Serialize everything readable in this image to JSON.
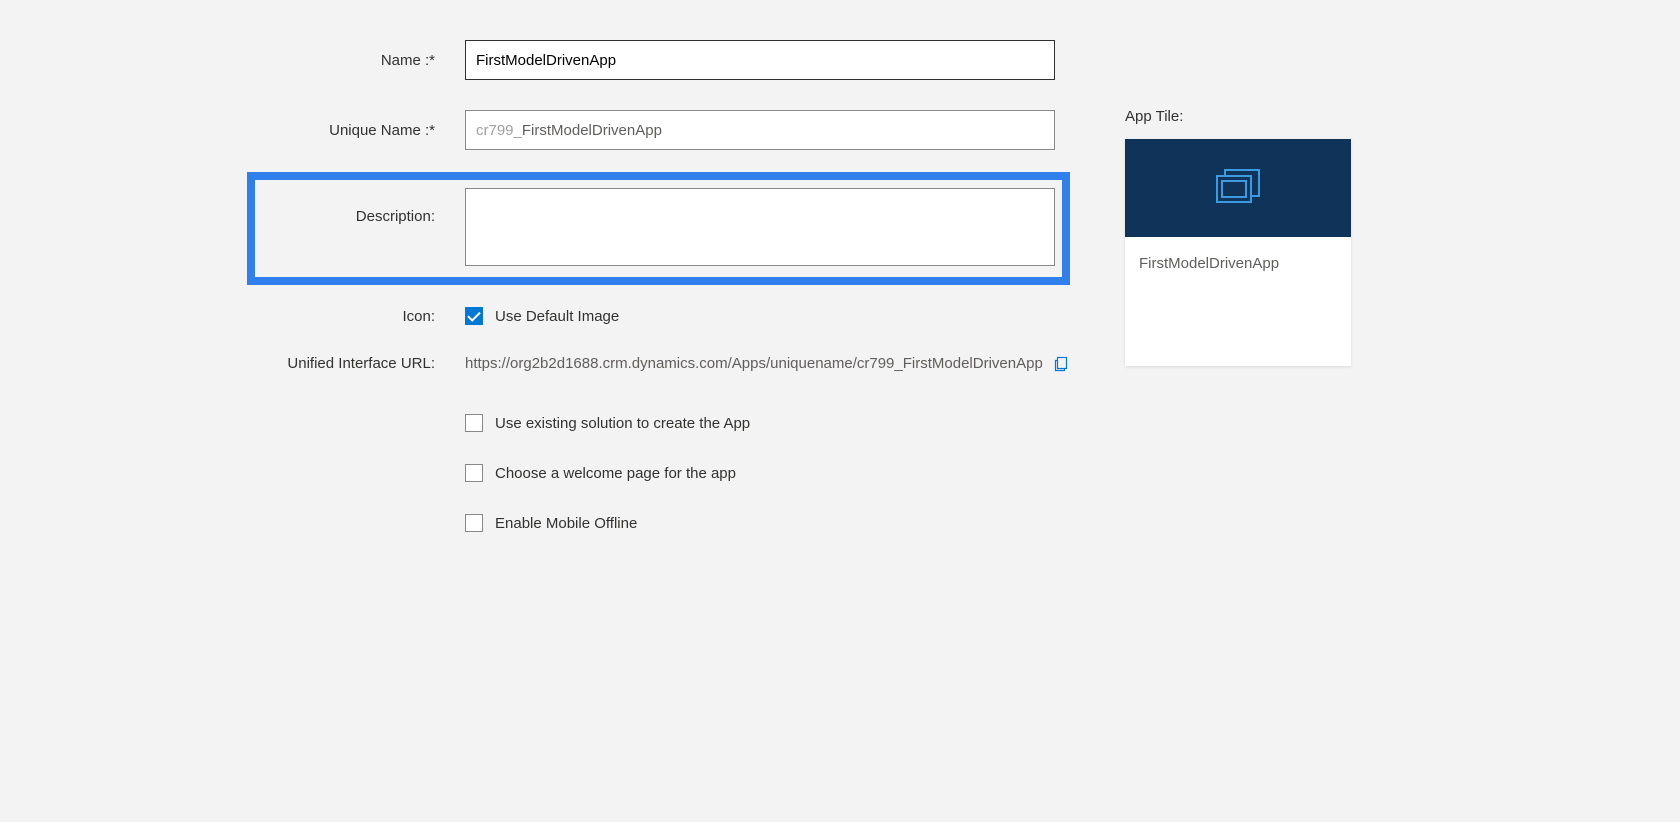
{
  "form": {
    "labels": {
      "name": "Name :*",
      "unique_name": "Unique Name :*",
      "description": "Description:",
      "icon": "Icon:",
      "url": "Unified Interface URL:"
    },
    "name_value": "FirstModelDrivenApp",
    "unique_name_prefix": "cr799_",
    "unique_name_value": "FirstModelDrivenApp",
    "description_value": "",
    "icon_checkbox_label": "Use Default Image",
    "url_value": "https://org2b2d1688.crm.dynamics.com/Apps/uniquename/cr799_FirstModelDrivenApp",
    "options": {
      "use_existing": "Use existing solution to create the App",
      "welcome_page": "Choose a welcome page for the app",
      "mobile_offline": "Enable Mobile Offline"
    }
  },
  "right": {
    "label": "App Tile:",
    "tile_name": "FirstModelDrivenApp"
  }
}
